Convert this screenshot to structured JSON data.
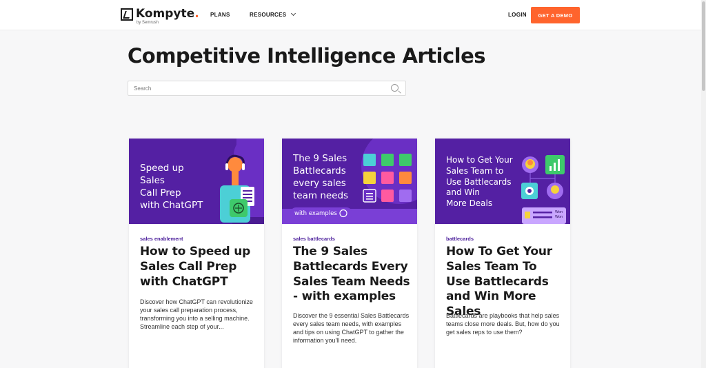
{
  "header": {
    "logo_text": "Kompyte",
    "logo_dot": ".",
    "logo_sub": "by Semrush",
    "nav": {
      "plans": "PLANS",
      "resources": "RESOURCES"
    },
    "login": "LOGIN",
    "cta": "GET A DEMO"
  },
  "page": {
    "title": "Competitive Intelligence Articles",
    "search_placeholder": "Search"
  },
  "cards": [
    {
      "image_lines": [
        "Speed up",
        "Sales",
        "Call Prep",
        "with ChatGPT"
      ],
      "tag": "sales enablement",
      "title": "How to Speed up Sales Call Prep with ChatGPT",
      "description": "Discover how ChatGPT can revolutionize your sales call preparation process, transforming you into a selling machine. Streamline each step of your..."
    },
    {
      "image_lines": [
        "The 9 Sales",
        "Battlecards",
        "every sales",
        "team needs"
      ],
      "image_pill": "with examples",
      "tag": "sales battlecards",
      "title": "The 9 Sales Battlecards Every Sales Team Needs - with examples",
      "description": "Discover the 9 essential Sales Battlecards every sales team needs, with examples and tips on using ChatGPT to gather the information you'll need."
    },
    {
      "image_lines": [
        "How to Get Your",
        "Sales Team to",
        "Use Battlecards",
        "and Win",
        "More Deals"
      ],
      "image_badge_1": "Won",
      "image_badge_2": "Won",
      "tag": "battlecards",
      "title": "How To Get Your Sales Team To Use Battlecards and Win More Sales",
      "description": "Battlecards are playbooks that help sales teams close more deals. But, how do you get sales reps to use them?"
    }
  ],
  "colors": {
    "accent": "#ff642d",
    "brand_purple": "#5420a3",
    "tag_purple": "#4b1e9b"
  }
}
